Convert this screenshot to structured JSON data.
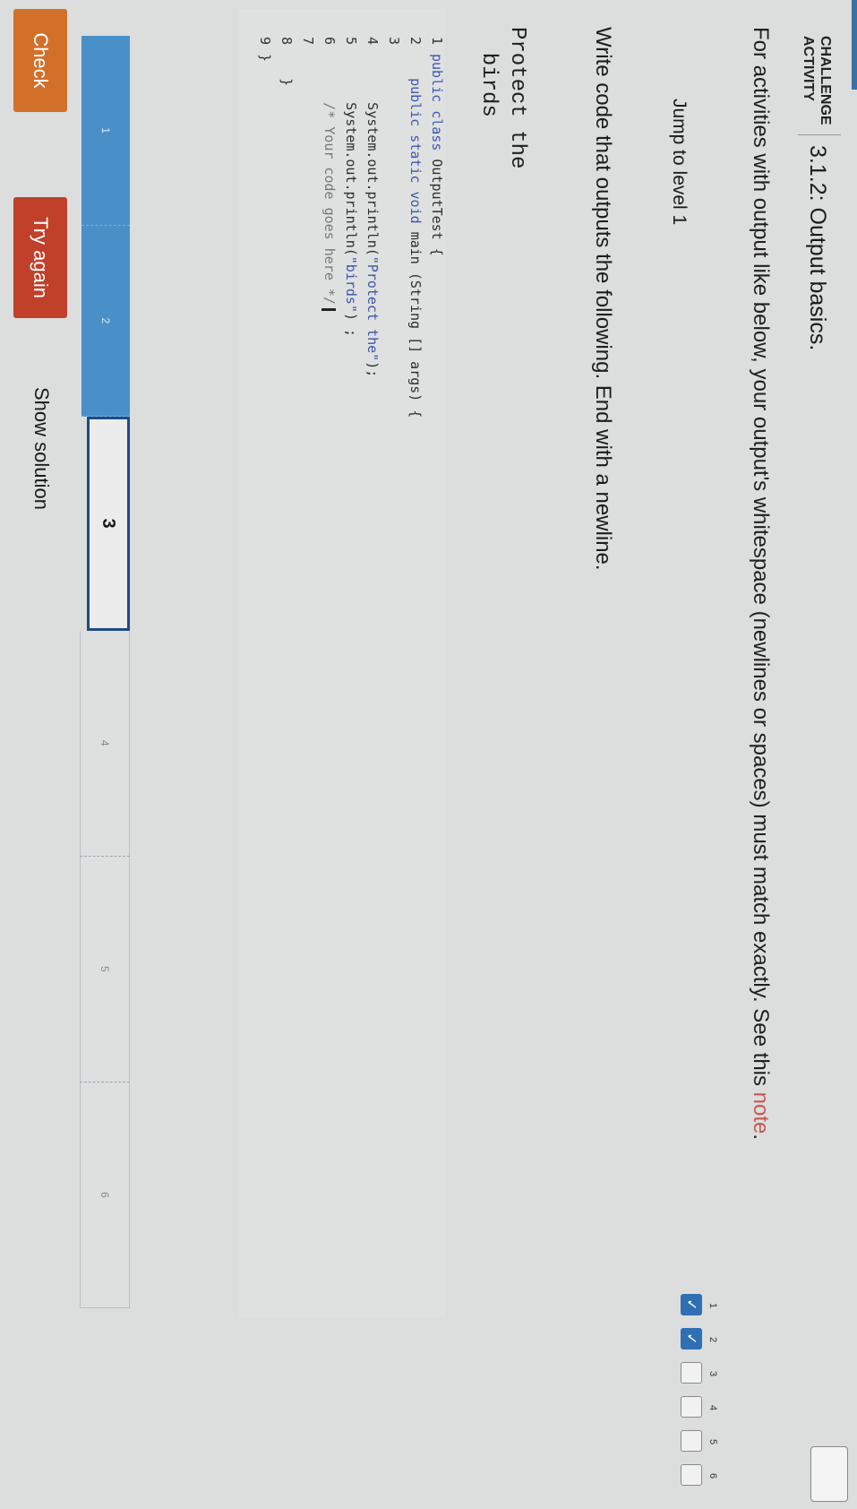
{
  "header": {
    "label": "CHALLENGE ACTIVITY",
    "title": "3.1.2: Output basics."
  },
  "instructions": {
    "text": "For activities with output like below, your output's whitespace (newlines or spaces) must match exactly. See this ",
    "link": "note",
    "suffix": "."
  },
  "jump": {
    "label": "Jump to level 1",
    "levels": [
      {
        "num": "1",
        "done": true
      },
      {
        "num": "2",
        "done": true
      },
      {
        "num": "3",
        "done": false
      },
      {
        "num": "4",
        "done": false
      },
      {
        "num": "5",
        "done": false
      },
      {
        "num": "6",
        "done": false
      }
    ],
    "checkmark": "✓"
  },
  "task": "Write code that outputs the following. End with a newline.",
  "expected_output": "Protect the\n  birds",
  "code": [
    {
      "num": "1",
      "parts": [
        {
          "t": "public class ",
          "c": "kw"
        },
        {
          "t": "OutputTest {",
          "c": ""
        }
      ]
    },
    {
      "num": "2",
      "parts": [
        {
          "t": "   public static void ",
          "c": "kw"
        },
        {
          "t": "main (String [] args) {",
          "c": ""
        }
      ]
    },
    {
      "num": "3",
      "parts": []
    },
    {
      "num": "4",
      "parts": [
        {
          "t": "      System.out.println(",
          "c": ""
        },
        {
          "t": "\"Protect the\"",
          "c": "str"
        },
        {
          "t": ");",
          "c": ""
        }
      ]
    },
    {
      "num": "5",
      "parts": [
        {
          "t": "      System.out.println(",
          "c": ""
        },
        {
          "t": "\"birds\"",
          "c": "str"
        },
        {
          "t": ") ;",
          "c": ""
        }
      ]
    },
    {
      "num": "6",
      "parts": [
        {
          "t": "      /* Your code goes here */",
          "c": "cm"
        }
      ],
      "cursor": true
    },
    {
      "num": "7",
      "parts": []
    },
    {
      "num": "8",
      "parts": [
        {
          "t": "   }",
          "c": ""
        }
      ]
    },
    {
      "num": "9",
      "parts": [
        {
          "t": "}",
          "c": ""
        }
      ]
    }
  ],
  "progress": [
    {
      "label": "1",
      "state": "done"
    },
    {
      "label": "2",
      "state": "done"
    },
    {
      "label": "3",
      "state": "current"
    },
    {
      "label": "4",
      "state": "todo"
    },
    {
      "label": "5",
      "state": "todo"
    },
    {
      "label": "6",
      "state": "todo"
    }
  ],
  "buttons": {
    "check": "Check",
    "try_again": "Try again",
    "show_solution": "Show solution"
  },
  "colors": {
    "accent": "#3b6fa6",
    "progress_done": "#4a90c8",
    "check_button": "#d2702a",
    "try_again_button": "#c0402a"
  }
}
